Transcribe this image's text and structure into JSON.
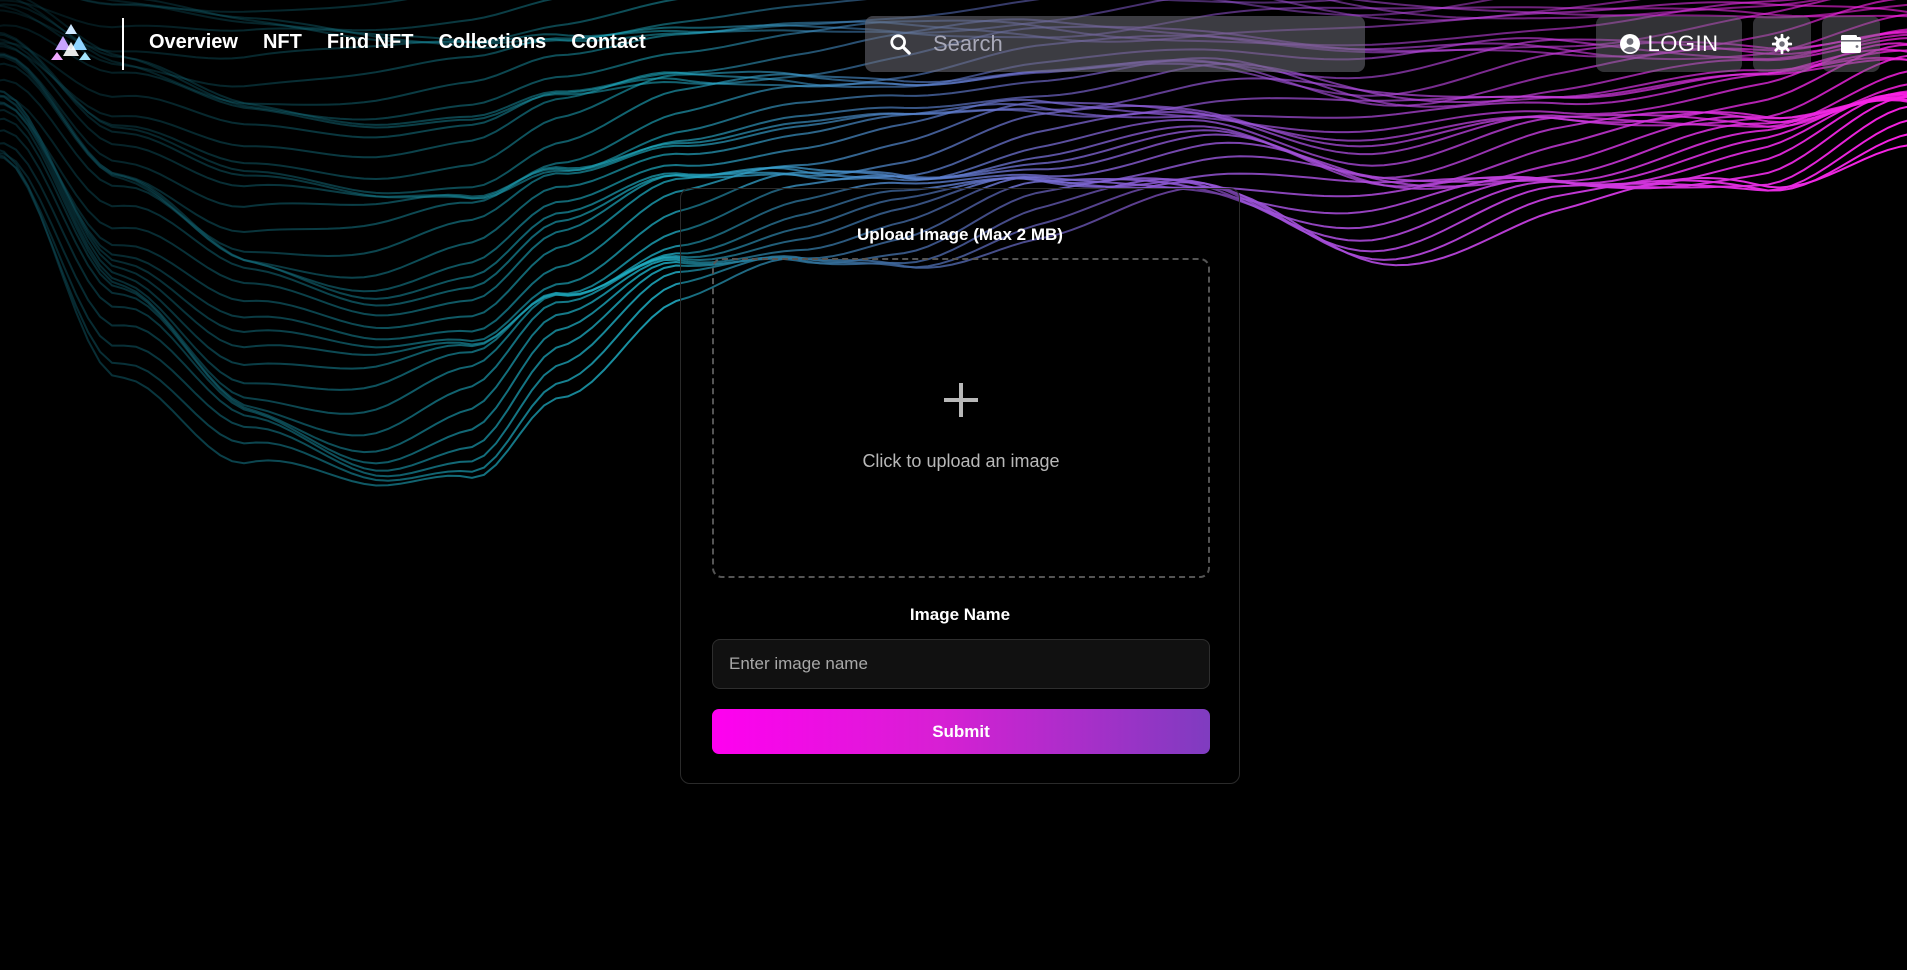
{
  "header": {
    "nav": [
      {
        "label": "Overview"
      },
      {
        "label": "NFT"
      },
      {
        "label": "Find NFT"
      },
      {
        "label": "Collections"
      },
      {
        "label": "Contact"
      }
    ],
    "search": {
      "placeholder": "Search",
      "icon": "search-icon"
    },
    "login": {
      "label": "LOGIN",
      "icon": "user-circle-icon"
    },
    "settings": {
      "icon": "gear-icon"
    },
    "wallet": {
      "icon": "wallet-icon"
    }
  },
  "form": {
    "upload_label": "Upload Image (Max 2 MB)",
    "dropzone_text": "Click to upload an image",
    "dropzone_icon": "plus-icon",
    "name_label": "Image Name",
    "name_placeholder": "Enter image name",
    "name_value": "",
    "submit_label": "Submit"
  },
  "colors": {
    "accent_magenta": "#ff00f0",
    "accent_purple": "#7f3cc0",
    "wave_cyan": "#1fb3c9",
    "background": "#000000"
  }
}
